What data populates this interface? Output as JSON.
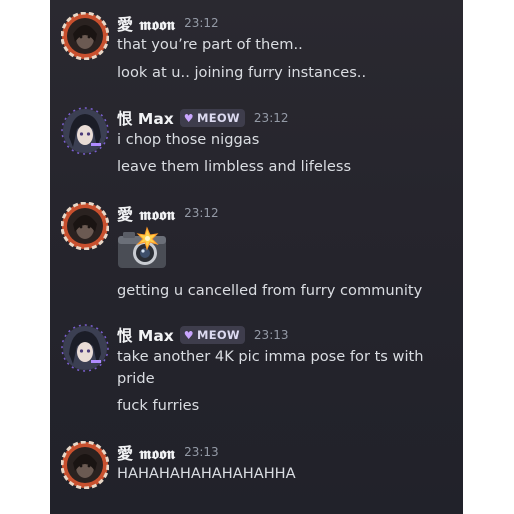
{
  "users": {
    "moon": {
      "name": "愛 𝖒𝖔𝖔𝖓"
    },
    "max": {
      "name": "恨 Max",
      "tag": "MEOW"
    }
  },
  "messages": [
    {
      "author": "moon",
      "time": "23:12",
      "lines": [
        "that you’re part of them..",
        "look at u.. joining furry instances.."
      ]
    },
    {
      "author": "max",
      "time": "23:12",
      "lines": [
        "i chop those niggas",
        "leave them limbless and lifeless"
      ]
    },
    {
      "author": "moon",
      "time": "23:12",
      "emoji": "camera-flash-emoji",
      "lines": [
        "getting u cancelled from furry community"
      ]
    },
    {
      "author": "max",
      "time": "23:13",
      "lines": [
        "take another 4K pic imma pose for ts with pride",
        "fuck furries"
      ]
    },
    {
      "author": "moon",
      "time": "23:13",
      "lines": [
        "HAHAHAHAHAHAHAHHA"
      ]
    }
  ],
  "colors": {
    "background": "#26252d",
    "text": "#dadde2",
    "username": "#f2f3f5",
    "timestamp": "#949aa6",
    "tag_bg": "#3e3d4c",
    "tag_heart": "#c9a6ff"
  }
}
